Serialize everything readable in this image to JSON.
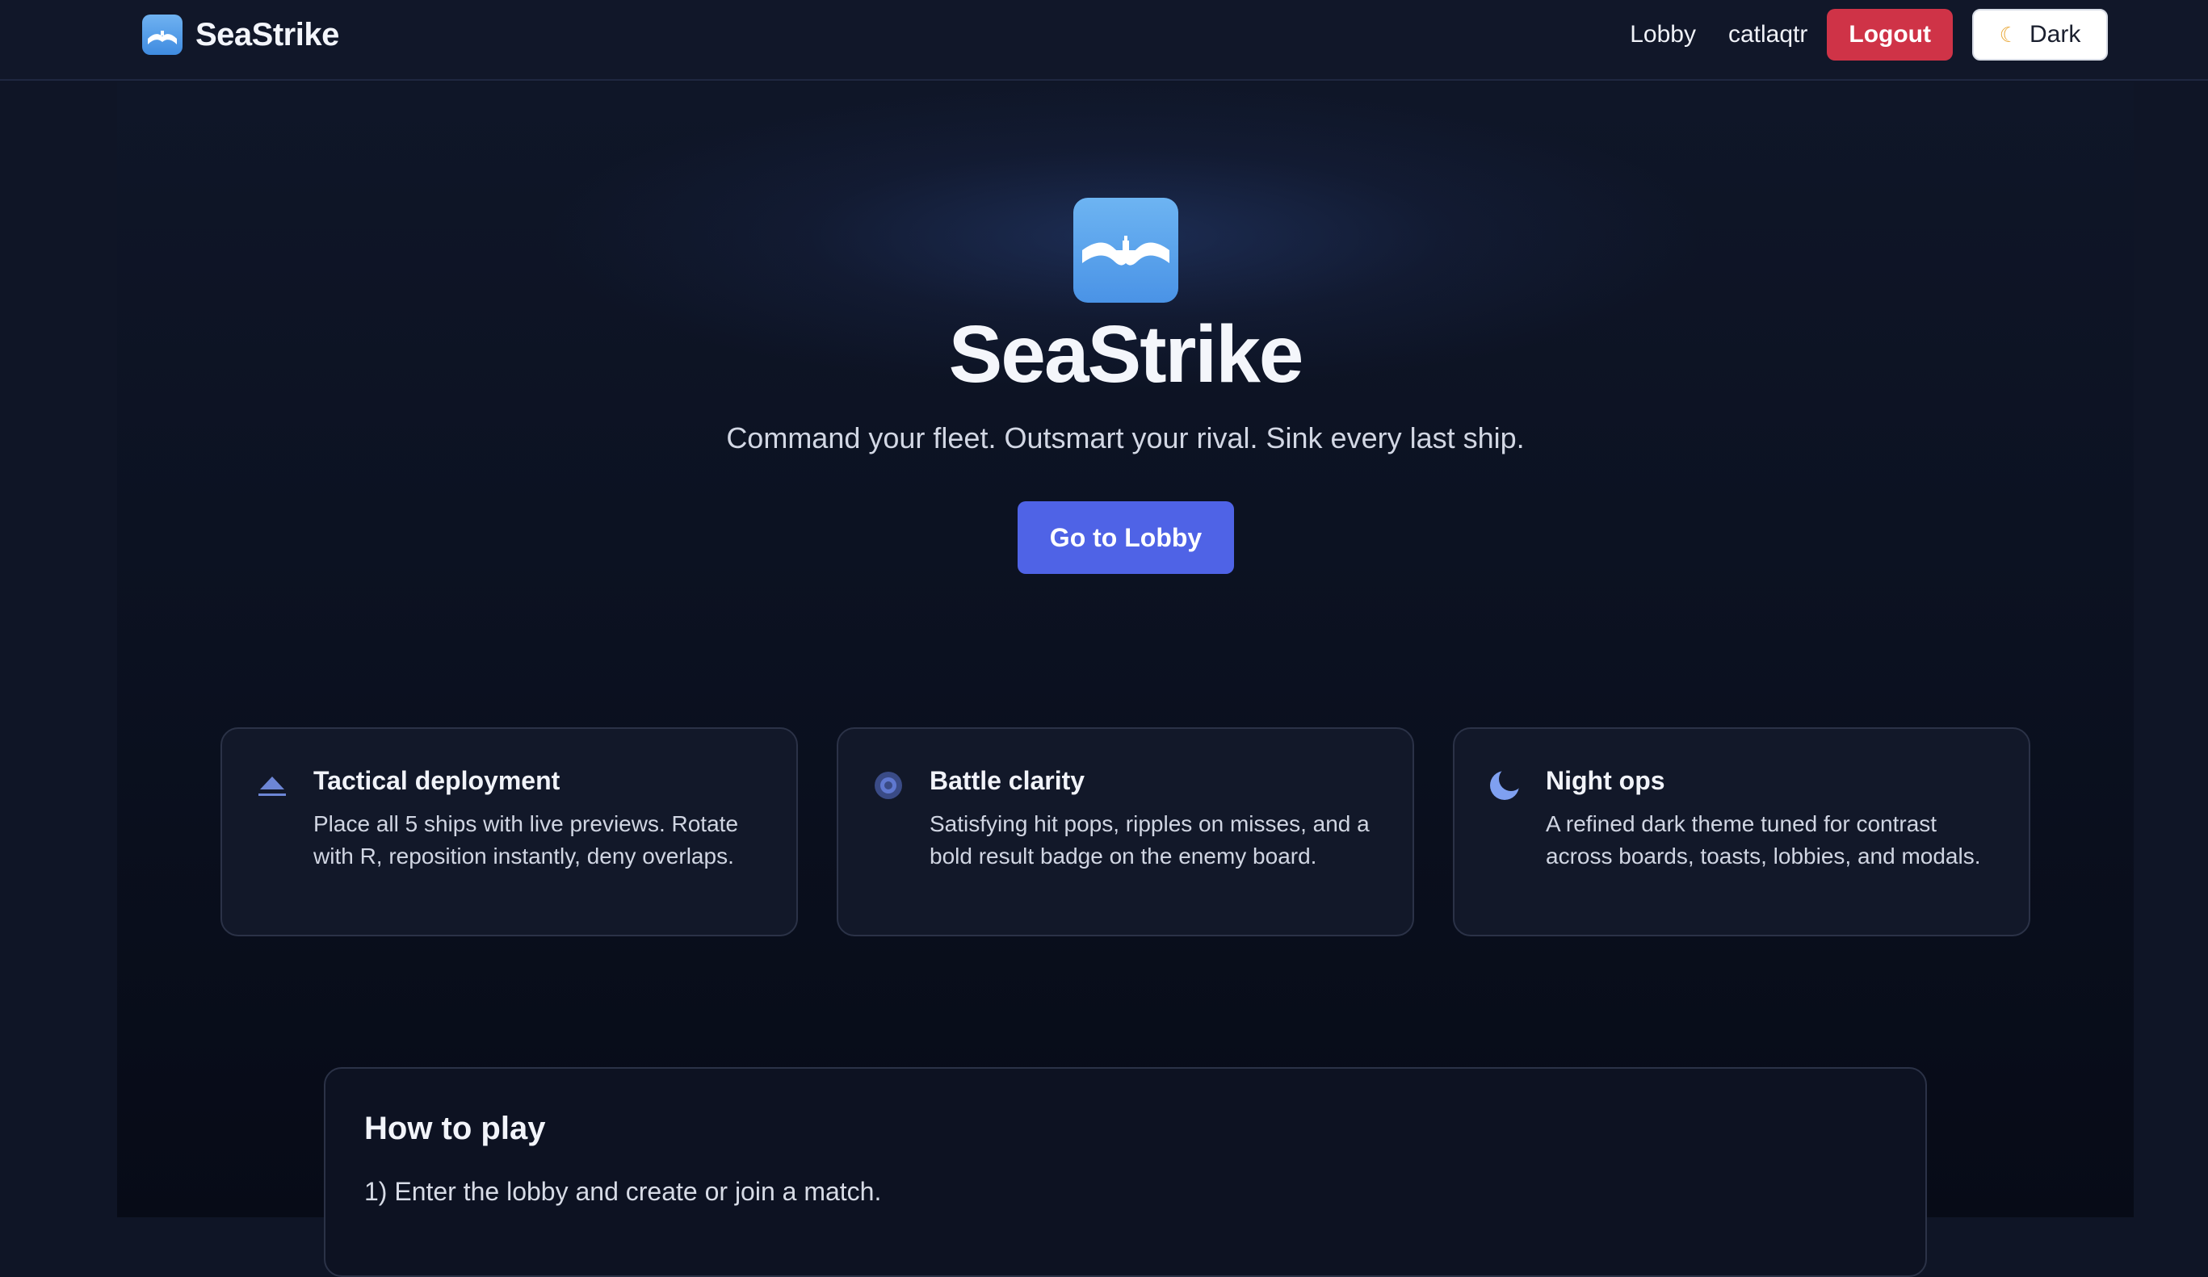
{
  "header": {
    "brand": "SeaStrike",
    "nav_lobby": "Lobby",
    "username": "catlaqtr",
    "logout_label": "Logout",
    "theme_label": "Dark",
    "theme_icon": "moon-icon"
  },
  "hero": {
    "title": "SeaStrike",
    "tagline": "Command your fleet. Outsmart your rival. Sink every last ship.",
    "cta_label": "Go to Lobby",
    "logo_icon": "ship-wave-icon"
  },
  "features": [
    {
      "icon": "ship-icon",
      "title": "Tactical deployment",
      "description": "Place all 5 ships with live previews. Rotate with R, reposition instantly, deny overlaps."
    },
    {
      "icon": "target-icon",
      "title": "Battle clarity",
      "description": "Satisfying hit pops, ripples on misses, and a bold result badge on the enemy board."
    },
    {
      "icon": "moon-icon",
      "title": "Night ops",
      "description": "A refined dark theme tuned for contrast across boards, toasts, lobbies, and modals."
    }
  ],
  "how_to_play": {
    "title": "How to play",
    "steps": [
      "1) Enter the lobby and create or join a match."
    ]
  },
  "colors": {
    "accent": "#4f63e6",
    "danger": "#cf3347",
    "background": "#0f1526",
    "brand_blue": "#5aa4ec"
  }
}
